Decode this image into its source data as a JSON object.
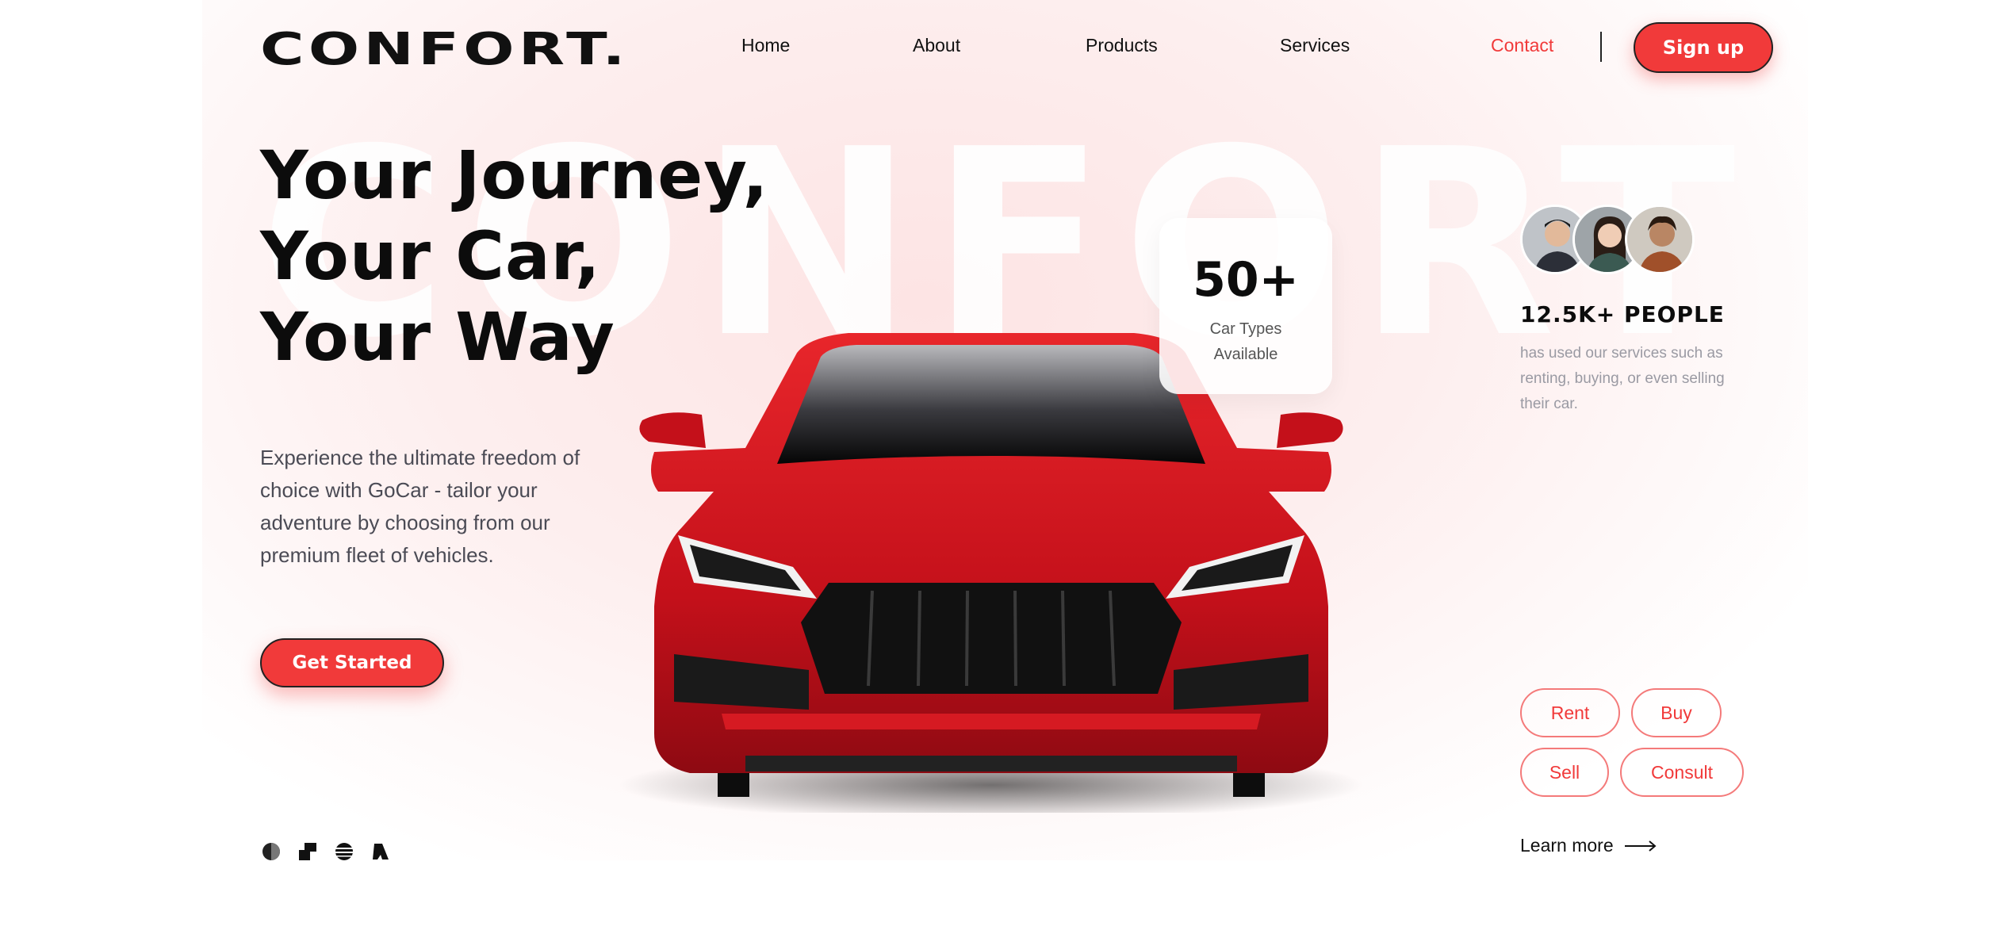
{
  "brand": {
    "logo": "CONFORT.",
    "background_word": "CONFORT",
    "accent_color": "#f13a3a"
  },
  "nav": {
    "items": [
      {
        "label": "Home"
      },
      {
        "label": "About"
      },
      {
        "label": "Products"
      },
      {
        "label": "Services"
      },
      {
        "label": "Contact",
        "active": true
      }
    ],
    "signup_label": "Sign up"
  },
  "hero": {
    "headline": [
      "Your Journey,",
      "Your Car,",
      "Your Way"
    ],
    "description": "Experience the ultimate freedom of choice with GoCar - tailor your adventure by choosing from our premium fleet of vehicles.",
    "cta_label": "Get Started"
  },
  "stat": {
    "value": "50+",
    "label_line1": "Car Types",
    "label_line2": "Available"
  },
  "people": {
    "title": "12.5K+ PEOPLE",
    "description": "has used our services such as renting, buying, or even selling their car."
  },
  "services": [
    "Rent",
    "Buy",
    "Sell",
    "Consult"
  ],
  "learn_more": {
    "label": "Learn more",
    "icon": "arrow-right-icon"
  },
  "partner_icons": [
    "partner-logo-circle-icon",
    "partner-logo-blocks-icon",
    "partner-logo-stripes-icon",
    "partner-logo-shape-icon"
  ]
}
